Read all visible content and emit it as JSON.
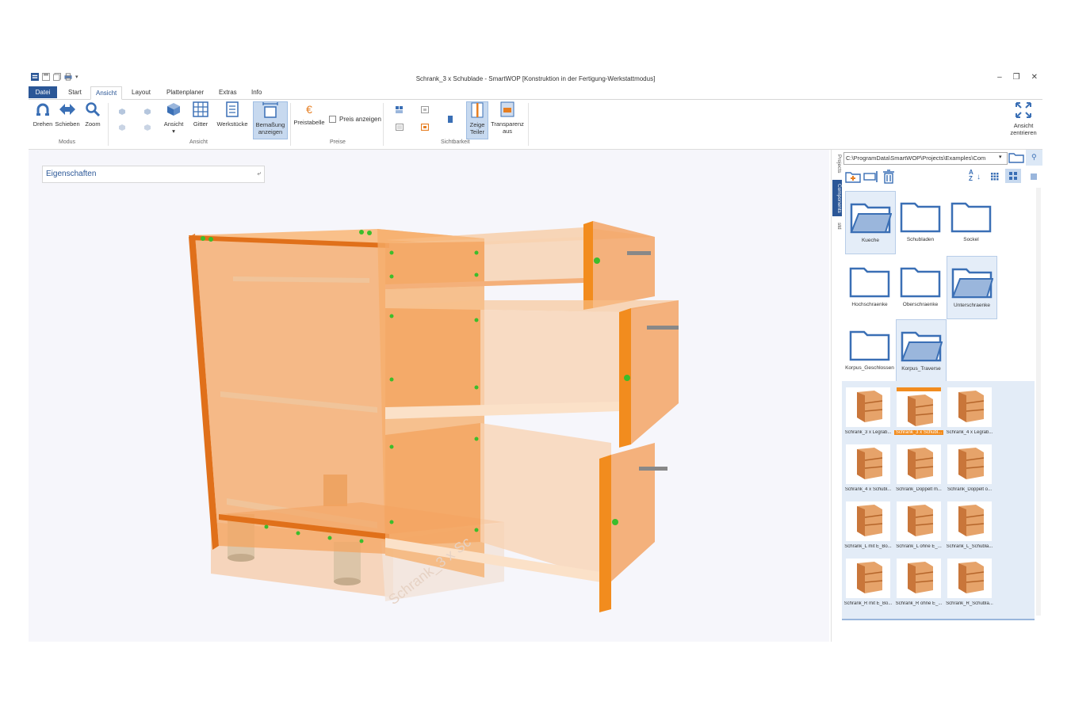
{
  "window": {
    "title": "Schrank_3 x Schublade - SmartWOP [Konstruktion in der Fertigung-Werkstattmodus]",
    "controls": [
      "–",
      "❐",
      "✕"
    ]
  },
  "tabs": [
    "Datei",
    "Start",
    "Ansicht",
    "Layout",
    "Plattenplaner",
    "Extras",
    "Info"
  ],
  "ribbon": {
    "drehen": "Drehen",
    "schieben": "Schieben",
    "zoom": "Zoom",
    "ansicht": "Ansicht",
    "gitter": "Gitter",
    "werkstuecke": "Werkstücke",
    "bemassung": "Bemaßung anzeigen",
    "preistabelle": "Preistabelle",
    "preis_anzeigen": "Preis anzeigen",
    "zeige_teiler": "Zeige Teiler",
    "transparenz": "Transparenz aus",
    "ansicht_zentrieren": "Ansicht zentrieren",
    "groups": {
      "modus": "Modus",
      "ansicht": "Ansicht",
      "preise": "Preise",
      "sichtbarkeit": "Sichtbarkeit"
    }
  },
  "properties": {
    "label": "Eigenschaften"
  },
  "side_tabs": [
    "Projects",
    "Components",
    "std"
  ],
  "panel": {
    "path": "C:\\ProgramData\\SmartWOP\\Projects\\Examples\\Com",
    "folders": [
      "Kueche",
      "Schubladen",
      "Sockel",
      "Hochschraenke",
      "Oberschraenke",
      "Unterschraenke",
      "Korpus_Geschlossen",
      "Korpus_Traverse"
    ],
    "thumbs": [
      "Schrank_3 x Legrab...",
      "Schrank_3 x Schubl...",
      "Schrank_4 x Legrab...",
      "Schrank_4 x Schubl...",
      "Schrank_Doppelt m...",
      "Schrank_Doppelt o...",
      "Schrank_L mit E_Bo...",
      "Schrank_L ohne E_...",
      "Schrank_L_Schubla...",
      "Schrank_R mit E_Bo...",
      "Schrank_R ohne E_...",
      "Schrank_R_Schubla..."
    ]
  },
  "watermark": "Schrank_3 x Sc",
  "colors": {
    "accent": "#2b5797",
    "orange": "#f28c1e",
    "selected": "#c7d9ef"
  }
}
